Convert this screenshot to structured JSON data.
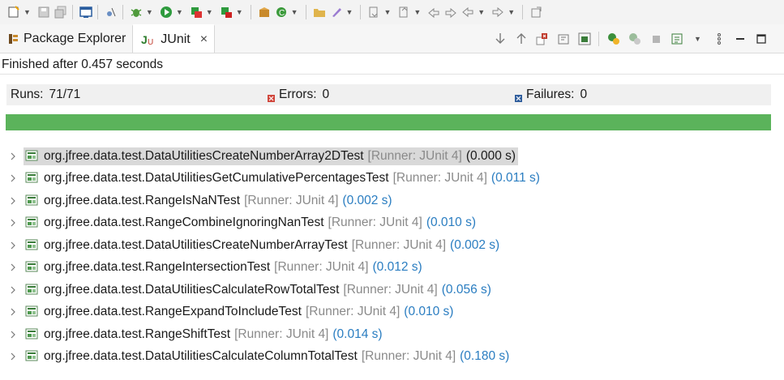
{
  "toolbar": {
    "icons": [
      "new-icon",
      "save-icon",
      "save-all-icon",
      "console-icon",
      "skip-breakpoints-icon",
      "debug-icon",
      "run-icon",
      "coverage-icon",
      "run-external-icon",
      "new-package-icon",
      "new-class-icon",
      "open-folder-icon",
      "pen-icon",
      "next-annotation-icon",
      "prev-annotation-icon",
      "last-edit-icon",
      "back-icon",
      "forward-icon",
      "pin-icon"
    ]
  },
  "tabs": {
    "package_explorer": "Package Explorer",
    "junit": "JUnit",
    "close": "×"
  },
  "status": {
    "message": "Finished after 0.457 seconds"
  },
  "counters": {
    "runs_label": "Runs:",
    "runs_value": "71/71",
    "errors_label": "Errors:",
    "errors_value": "0",
    "failures_label": "Failures:",
    "failures_value": "0"
  },
  "progress": {
    "fraction": 1.0,
    "color": "#5bb35b"
  },
  "tests": [
    {
      "name": "org.jfree.data.test.DataUtilitiesCreateNumberArray2DTest",
      "runner": "[Runner: JUnit 4]",
      "time": "(0.000 s)"
    },
    {
      "name": "org.jfree.data.test.DataUtilitiesGetCumulativePercentagesTest",
      "runner": "[Runner: JUnit 4]",
      "time": "(0.011 s)"
    },
    {
      "name": "org.jfree.data.test.RangeIsNaNTest",
      "runner": "[Runner: JUnit 4]",
      "time": "(0.002 s)"
    },
    {
      "name": "org.jfree.data.test.RangeCombineIgnoringNanTest",
      "runner": "[Runner: JUnit 4]",
      "time": "(0.010 s)"
    },
    {
      "name": "org.jfree.data.test.DataUtilitiesCreateNumberArrayTest",
      "runner": "[Runner: JUnit 4]",
      "time": "(0.002 s)"
    },
    {
      "name": "org.jfree.data.test.RangeIntersectionTest",
      "runner": "[Runner: JUnit 4]",
      "time": "(0.012 s)"
    },
    {
      "name": "org.jfree.data.test.DataUtilitiesCalculateRowTotalTest",
      "runner": "[Runner: JUnit 4]",
      "time": "(0.056 s)"
    },
    {
      "name": "org.jfree.data.test.RangeExpandToIncludeTest",
      "runner": "[Runner: JUnit 4]",
      "time": "(0.010 s)"
    },
    {
      "name": "org.jfree.data.test.RangeShiftTest",
      "runner": "[Runner: JUnit 4]",
      "time": "(0.014 s)"
    },
    {
      "name": "org.jfree.data.test.DataUtilitiesCalculateColumnTotalTest",
      "runner": "[Runner: JUnit 4]",
      "time": "(0.180 s)"
    }
  ]
}
